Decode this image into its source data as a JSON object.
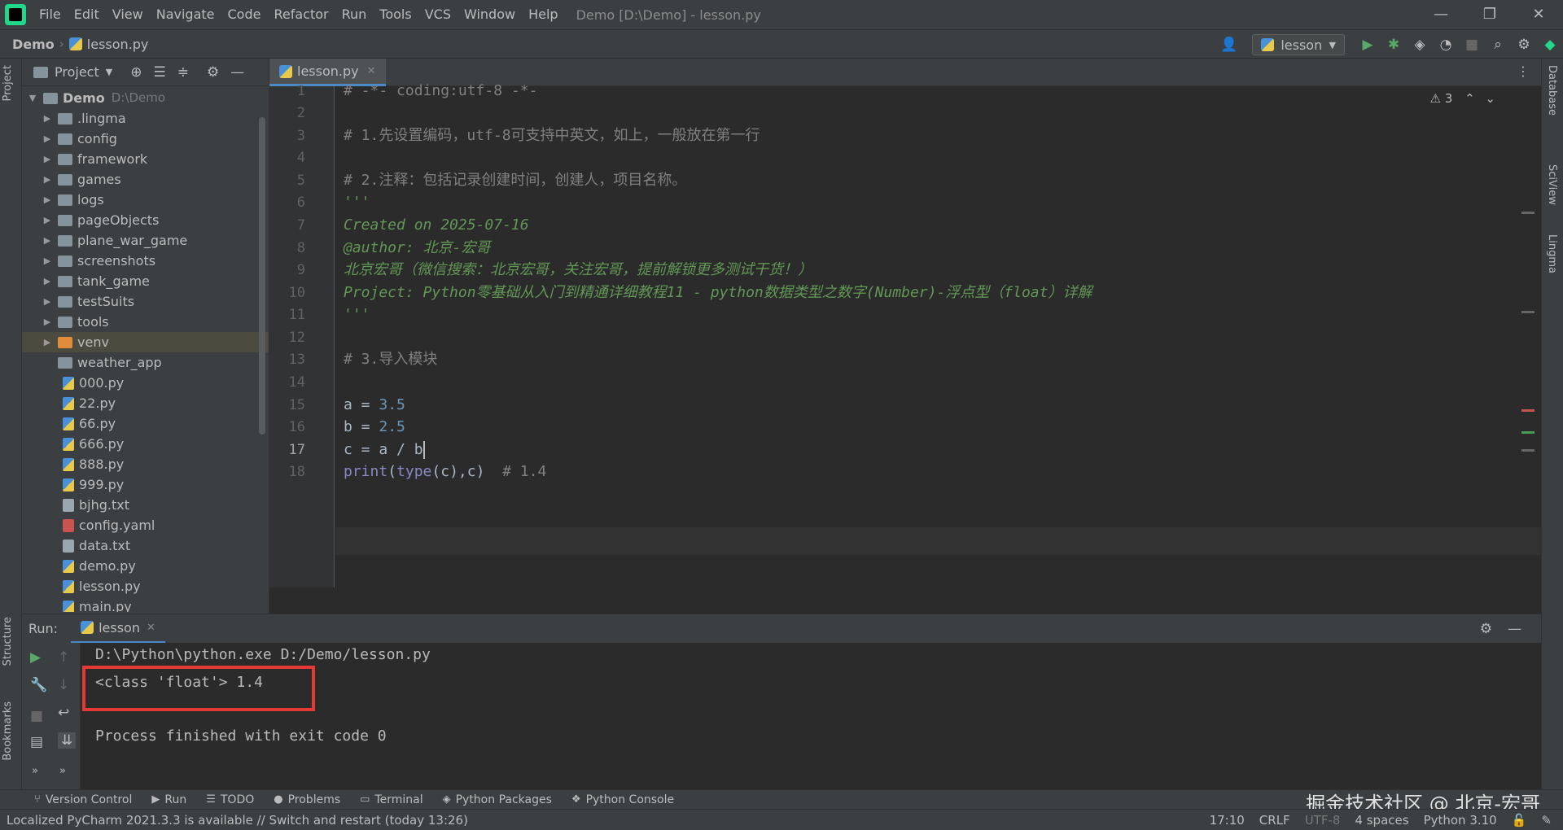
{
  "menubar": {
    "items": [
      "File",
      "Edit",
      "View",
      "Navigate",
      "Code",
      "Refactor",
      "Run",
      "Tools",
      "VCS",
      "Window",
      "Help"
    ],
    "window_title": "Demo [D:\\Demo] - lesson.py"
  },
  "navbar": {
    "root": "Demo",
    "file": "lesson.py",
    "run_config": "lesson"
  },
  "project": {
    "title": "Project",
    "root_name": "Demo",
    "root_path": "D:\\Demo",
    "folders": [
      "lingma_dot",
      ".lingma",
      "config",
      "framework",
      "games",
      "logs",
      "pageObjects",
      "plane_war_game",
      "screenshots",
      "tank_game",
      "testSuits",
      "tools",
      "venv",
      "weather_app"
    ],
    "files": [
      "000.py",
      "22.py",
      "66.py",
      "666.py",
      "888.py",
      "999.py",
      "bjhg.txt",
      "config.yaml",
      "data.txt",
      "demo.py",
      "lesson.py",
      "main.py"
    ]
  },
  "tree": [
    {
      "label": ".lingma",
      "type": "folder"
    },
    {
      "label": "config",
      "type": "folder"
    },
    {
      "label": "framework",
      "type": "folder"
    },
    {
      "label": "games",
      "type": "folder"
    },
    {
      "label": "logs",
      "type": "folder"
    },
    {
      "label": "pageObjects",
      "type": "folder"
    },
    {
      "label": "plane_war_game",
      "type": "folder"
    },
    {
      "label": "screenshots",
      "type": "folder"
    },
    {
      "label": "tank_game",
      "type": "folder"
    },
    {
      "label": "testSuits",
      "type": "folder"
    },
    {
      "label": "tools",
      "type": "folder"
    },
    {
      "label": "venv",
      "type": "folder-orange"
    },
    {
      "label": "weather_app",
      "type": "folder-noarrow"
    },
    {
      "label": "000.py",
      "type": "py"
    },
    {
      "label": "22.py",
      "type": "py"
    },
    {
      "label": "66.py",
      "type": "py"
    },
    {
      "label": "666.py",
      "type": "py"
    },
    {
      "label": "888.py",
      "type": "py"
    },
    {
      "label": "999.py",
      "type": "py"
    },
    {
      "label": "bjhg.txt",
      "type": "txt"
    },
    {
      "label": "config.yaml",
      "type": "yaml"
    },
    {
      "label": "data.txt",
      "type": "txt"
    },
    {
      "label": "demo.py",
      "type": "py"
    },
    {
      "label": "lesson.py",
      "type": "py"
    },
    {
      "label": "main.py",
      "type": "py"
    }
  ],
  "editor": {
    "tab": "lesson.py",
    "warnings": "3",
    "lines": [
      "# -*- coding:utf-8 -*-",
      "",
      "# 1.先设置编码，utf-8可支持中英文，如上，一般放在第一行",
      "",
      "# 2.注释：包括记录创建时间，创建人，项目名称。",
      "'''",
      "Created on 2025-07-16",
      "@author: 北京-宏哥",
      "北京宏哥（微信搜索：北京宏哥，关注宏哥，提前解锁更多测试干货！）",
      "Project: Python零基础从入门到精通详细教程11 - python数据类型之数字(Number)-浮点型（float）详解",
      "'''",
      "",
      "# 3.导入模块",
      "",
      "a = 3.5",
      "b = 2.5",
      "c = a / b",
      "print(type(c),c)  # 1.4"
    ],
    "code": {
      "a_var": "a = ",
      "a_val": "3.5",
      "b_var": "b = ",
      "b_val": "2.5",
      "c_expr": "c = a / b",
      "print_fn": "print",
      "print_open": "(",
      "type_fn": "type",
      "print_args": "(c),c)  ",
      "print_comment": "# 1.4"
    },
    "current_line": 17
  },
  "run": {
    "label": "Run:",
    "tab": "lesson",
    "output": [
      "D:\\Python\\python.exe D:/Demo/lesson.py",
      "<class 'float'> 1.4",
      "",
      "Process finished with exit code 0"
    ]
  },
  "tool_tabs": [
    "Version Control",
    "Run",
    "TODO",
    "Problems",
    "Terminal",
    "Python Packages",
    "Python Console"
  ],
  "watermark": "掘金技术社区 @ 北京-宏哥",
  "side_tabs": {
    "left": [
      "Project",
      "Structure",
      "Bookmarks"
    ],
    "right": [
      "Database",
      "SciView",
      "Lingma"
    ]
  },
  "status": {
    "message": "Localized PyCharm 2021.3.3 is available // Switch and restart (today 13:26)",
    "position": "17:10",
    "line_sep": "CRLF",
    "encoding": "UTF-8",
    "indent": "4 spaces",
    "interpreter": "Python 3.10"
  }
}
